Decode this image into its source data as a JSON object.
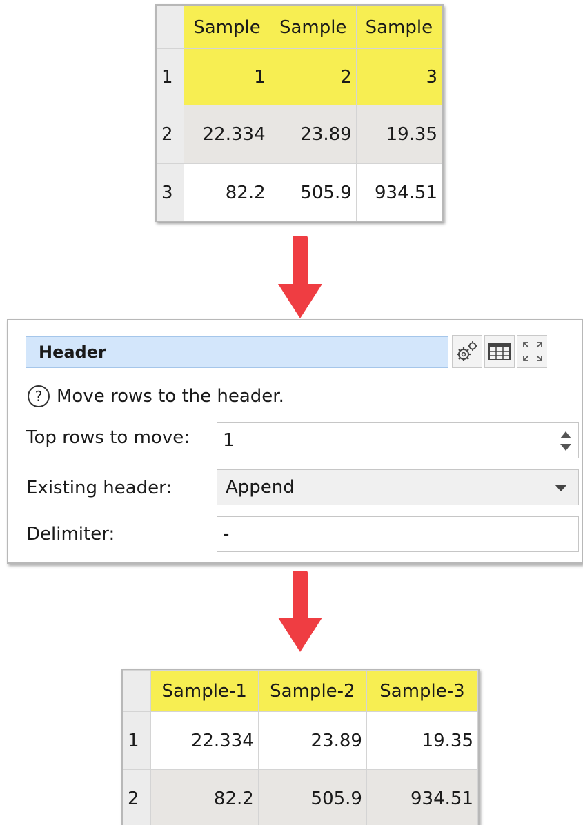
{
  "input_table": {
    "headers": [
      "Sample",
      "Sample",
      "Sample"
    ],
    "rows": [
      {
        "num": "1",
        "cells": [
          "1",
          "2",
          "3"
        ]
      },
      {
        "num": "2",
        "cells": [
          "22.334",
          "23.89",
          "19.35"
        ]
      },
      {
        "num": "3",
        "cells": [
          "82.2",
          "505.9",
          "934.51"
        ]
      }
    ]
  },
  "header_panel": {
    "title": "Header",
    "help_icon": "question-circle-icon",
    "help_text": "Move rows to the header.",
    "buttons": [
      "gears-icon",
      "table-icon",
      "expand-icon"
    ],
    "top_rows_label": "Top rows to move:",
    "top_rows_value": "1",
    "existing_header_label": "Existing header:",
    "existing_header_value": "Append",
    "delimiter_label": "Delimiter:",
    "delimiter_value": "-"
  },
  "output_table": {
    "headers": [
      "Sample-1",
      "Sample-2",
      "Sample-3"
    ],
    "rows": [
      {
        "num": "1",
        "cells": [
          "22.334",
          "23.89",
          "19.35"
        ]
      },
      {
        "num": "2",
        "cells": [
          "82.2",
          "505.9",
          "934.51"
        ]
      }
    ]
  },
  "colors": {
    "header_yellow": "#f7ee52",
    "arrow_red": "#ef3d42",
    "title_blue": "#d3e6fb",
    "row_grey": "#e8e6e3"
  }
}
